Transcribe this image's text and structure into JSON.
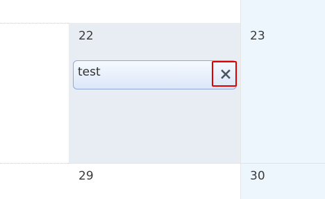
{
  "calendar": {
    "days": {
      "d22": "22",
      "d23": "23",
      "d29": "29",
      "d30": "30"
    },
    "event": {
      "title": "test",
      "delete_icon": "close-x-icon"
    }
  },
  "colors": {
    "selected_cell": "#e8edf4",
    "today_column": "#eef6fd",
    "event_border": "#8ea8d1",
    "highlight_border": "#e00000"
  }
}
